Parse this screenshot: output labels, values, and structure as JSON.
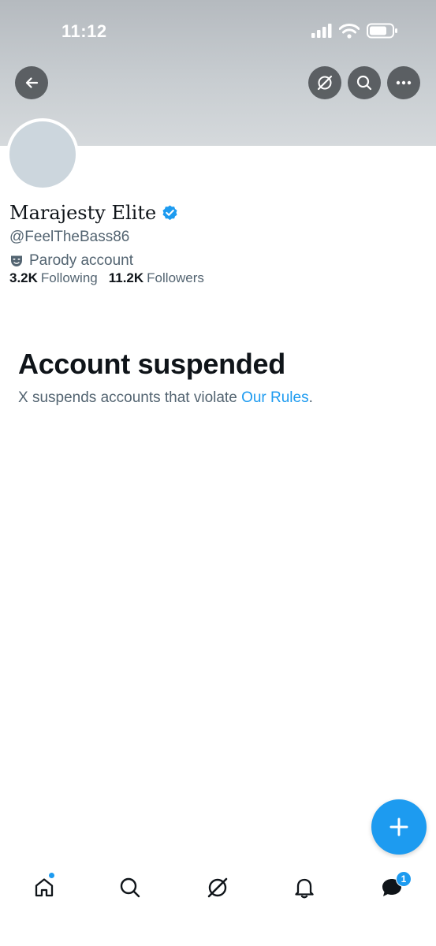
{
  "status_bar": {
    "time": "11:12"
  },
  "header_icons": [
    "back-arrow-icon",
    "grok-icon",
    "search-icon",
    "more-icon"
  ],
  "profile": {
    "display_name": "Marajesty Elite",
    "verified": true,
    "handle": "@FeelTheBass86",
    "parody_label": "Parody account",
    "following_count": "3.2K",
    "following_label": "Following",
    "followers_count": "11.2K",
    "followers_label": "Followers"
  },
  "suspension": {
    "title": "Account suspended",
    "message": "X suspends accounts that violate ",
    "link_text": "Our Rules",
    "period": "."
  },
  "bottom_nav": {
    "items": [
      "home-icon",
      "search-icon",
      "grok-icon",
      "notifications-icon",
      "messages-icon"
    ],
    "messages_badge": "1"
  },
  "colors": {
    "accent": "#1d9bf0",
    "text_primary": "#0f1419",
    "text_secondary": "#536471"
  }
}
